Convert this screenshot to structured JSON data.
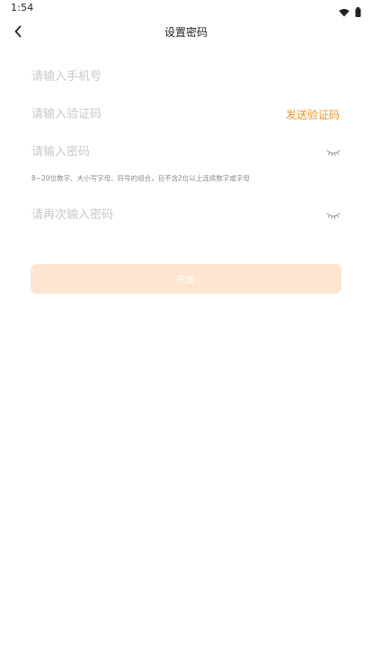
{
  "status_bar": {
    "time": "1:54",
    "icons": [
      "wifi-icon",
      "battery-icon"
    ]
  },
  "nav": {
    "title": "设置密码",
    "back_icon": "chevron-left-icon"
  },
  "form": {
    "phone": {
      "placeholder": "请输入手机号",
      "value": ""
    },
    "code": {
      "placeholder": "请输入验证码",
      "value": "",
      "send_label": "发送验证码"
    },
    "password": {
      "placeholder": "请输入密码",
      "value": "",
      "toggle_icon": "eye-closed-icon"
    },
    "hint": "8~20位数字、大小写字母、符号的组合，且不含2位以上连续数字或字母",
    "confirm_password": {
      "placeholder": "请再次输入密码",
      "value": "",
      "toggle_icon": "eye-closed-icon"
    },
    "submit_label": "完成"
  },
  "colors": {
    "accent": "#f0952b",
    "button_disabled_bg": "#fde5cf",
    "placeholder": "#c8c8c8",
    "hint": "#8a8a8a"
  }
}
